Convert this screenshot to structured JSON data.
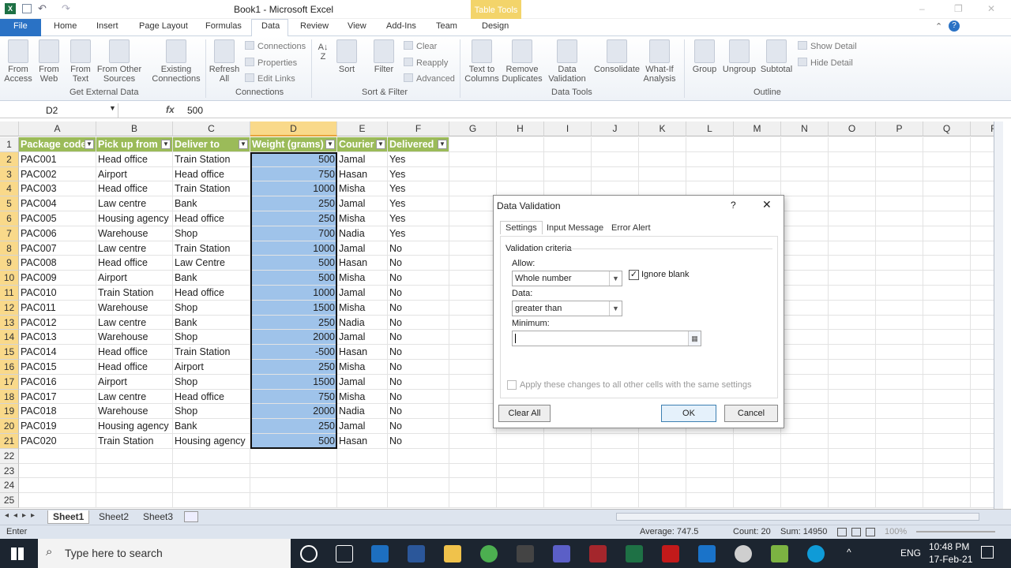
{
  "title": "Book1  -  Microsoft Excel",
  "contextual_group": "Table Tools",
  "tabs": [
    "File",
    "Home",
    "Insert",
    "Page Layout",
    "Formulas",
    "Data",
    "Review",
    "View",
    "Add-Ins",
    "Team",
    "Design"
  ],
  "active_tab": "Data",
  "ribbon": {
    "get_external": {
      "label": "Get External Data",
      "buttons": [
        "From\nAccess",
        "From\nWeb",
        "From\nText",
        "From Other\nSources",
        "Existing\nConnections"
      ]
    },
    "connections": {
      "label": "Connections",
      "refresh": "Refresh\nAll",
      "small": [
        "Connections",
        "Properties",
        "Edit Links"
      ]
    },
    "sort_filter": {
      "label": "Sort & Filter",
      "sort": "Sort",
      "filter": "Filter",
      "small": [
        "Clear",
        "Reapply",
        "Advanced"
      ]
    },
    "data_tools": {
      "label": "Data Tools",
      "buttons": [
        "Text to\nColumns",
        "Remove\nDuplicates",
        "Data\nValidation",
        "Consolidate",
        "What-If\nAnalysis"
      ]
    },
    "outline": {
      "label": "Outline",
      "buttons": [
        "Group",
        "Ungroup",
        "Subtotal"
      ],
      "small": [
        "Show Detail",
        "Hide Detail"
      ]
    }
  },
  "formula_bar": {
    "name_box": "D2",
    "fx": "fx",
    "value": "500"
  },
  "columns": [
    "A",
    "B",
    "C",
    "D",
    "E",
    "F",
    "G",
    "H",
    "I",
    "J",
    "K",
    "L",
    "M",
    "N",
    "O",
    "P",
    "Q",
    "R"
  ],
  "header_row": [
    "Package code",
    "Pick up from",
    "Deliver to",
    "Weight (grams)",
    "Courier",
    "Delivered"
  ],
  "rows": [
    [
      "PAC001",
      "Head office",
      "Train Station",
      "500",
      "Jamal",
      "Yes"
    ],
    [
      "PAC002",
      "Airport",
      "Head office",
      "750",
      "Hasan",
      "Yes"
    ],
    [
      "PAC003",
      "Head office",
      "Train Station",
      "1000",
      "Misha",
      "Yes"
    ],
    [
      "PAC004",
      "Law centre",
      "Bank",
      "250",
      "Jamal",
      "Yes"
    ],
    [
      "PAC005",
      "Housing agency",
      "Head office",
      "250",
      "Misha",
      "Yes"
    ],
    [
      "PAC006",
      "Warehouse",
      "Shop",
      "700",
      "Nadia",
      "Yes"
    ],
    [
      "PAC007",
      "Law centre",
      "Train Station",
      "1000",
      "Jamal",
      "No"
    ],
    [
      "PAC008",
      "Head office",
      "Law Centre",
      "500",
      "Hasan",
      "No"
    ],
    [
      "PAC009",
      "Airport",
      "Bank",
      "500",
      "Misha",
      "No"
    ],
    [
      "PAC010",
      "Train Station",
      "Head office",
      "1000",
      "Jamal",
      "No"
    ],
    [
      "PAC011",
      "Warehouse",
      "Shop",
      "1500",
      "Misha",
      "No"
    ],
    [
      "PAC012",
      "Law centre",
      "Bank",
      "250",
      "Nadia",
      "No"
    ],
    [
      "PAC013",
      "Warehouse",
      "Shop",
      "2000",
      "Jamal",
      "No"
    ],
    [
      "PAC014",
      "Head office",
      "Train Station",
      "-500",
      "Hasan",
      "No"
    ],
    [
      "PAC015",
      "Head office",
      "Airport",
      "250",
      "Misha",
      "No"
    ],
    [
      "PAC016",
      "Airport",
      "Shop",
      "1500",
      "Jamal",
      "No"
    ],
    [
      "PAC017",
      "Law centre",
      "Head office",
      "750",
      "Misha",
      "No"
    ],
    [
      "PAC018",
      "Warehouse",
      "Shop",
      "2000",
      "Nadia",
      "No"
    ],
    [
      "PAC019",
      "Housing agency",
      "Bank",
      "250",
      "Jamal",
      "No"
    ],
    [
      "PAC020",
      "Train Station",
      "Housing agency",
      "500",
      "Hasan",
      "No"
    ]
  ],
  "row_numbers": [
    "1",
    "2",
    "3",
    "4",
    "5",
    "6",
    "7",
    "8",
    "9",
    "10",
    "11",
    "12",
    "13",
    "14",
    "15",
    "16",
    "17",
    "18",
    "19",
    "20",
    "21",
    "22",
    "23",
    "24",
    "25"
  ],
  "sheets": [
    "Sheet1",
    "Sheet2",
    "Sheet3"
  ],
  "status": {
    "mode": "Enter",
    "average": "Average: 747.5",
    "count": "Count: 20",
    "sum": "Sum: 14950",
    "zoom": "100%"
  },
  "taskbar": {
    "search_placeholder": "Type here to search",
    "time": "10:48 PM",
    "date": "17-Feb-21",
    "lang": "ENG"
  },
  "dialog": {
    "title": "Data Validation",
    "help": "?",
    "tabs": [
      "Settings",
      "Input Message",
      "Error Alert"
    ],
    "section": "Validation criteria",
    "allow_label": "Allow:",
    "allow_value": "Whole number",
    "ignore_blank": "Ignore blank",
    "data_label": "Data:",
    "data_value": "greater than",
    "minimum_label": "Minimum:",
    "minimum_value": "",
    "apply_all": "Apply these changes to all other cells with the same settings",
    "clear_all": "Clear All",
    "ok": "OK",
    "cancel": "Cancel"
  }
}
